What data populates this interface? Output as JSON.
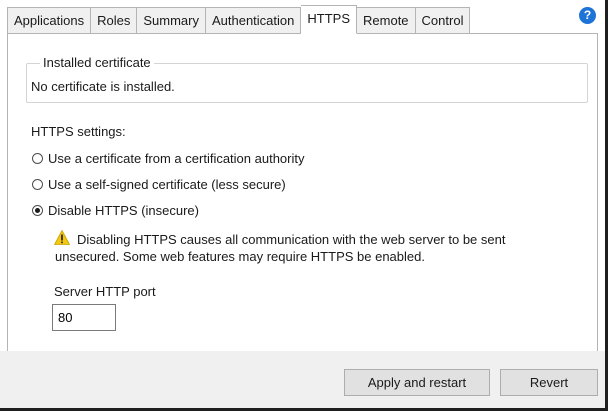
{
  "tabs": [
    {
      "label": "Applications"
    },
    {
      "label": "Roles"
    },
    {
      "label": "Summary"
    },
    {
      "label": "Authentication"
    },
    {
      "label": "HTTPS",
      "active": true
    },
    {
      "label": "Remote"
    },
    {
      "label": "Control"
    }
  ],
  "help": {
    "glyph": "?"
  },
  "installed_certificate": {
    "legend": "Installed certificate",
    "text": "No certificate is installed."
  },
  "https_settings": {
    "label": "HTTPS settings:",
    "options": [
      {
        "label": "Use a certificate from a certification authority",
        "checked": false
      },
      {
        "label": "Use a self-signed certificate (less secure)",
        "checked": false
      },
      {
        "label": "Disable HTTPS (insecure)",
        "checked": true
      }
    ]
  },
  "warning": {
    "line1": "Disabling HTTPS causes all communication with the web server to be sent",
    "line2": "unsecured. Some web features may require HTTPS be enabled.",
    "icon_color": "#f2c811"
  },
  "server_port": {
    "label": "Server HTTP port",
    "value": "80"
  },
  "buttons": {
    "apply_label": "Apply and restart",
    "revert_label": "Revert"
  }
}
